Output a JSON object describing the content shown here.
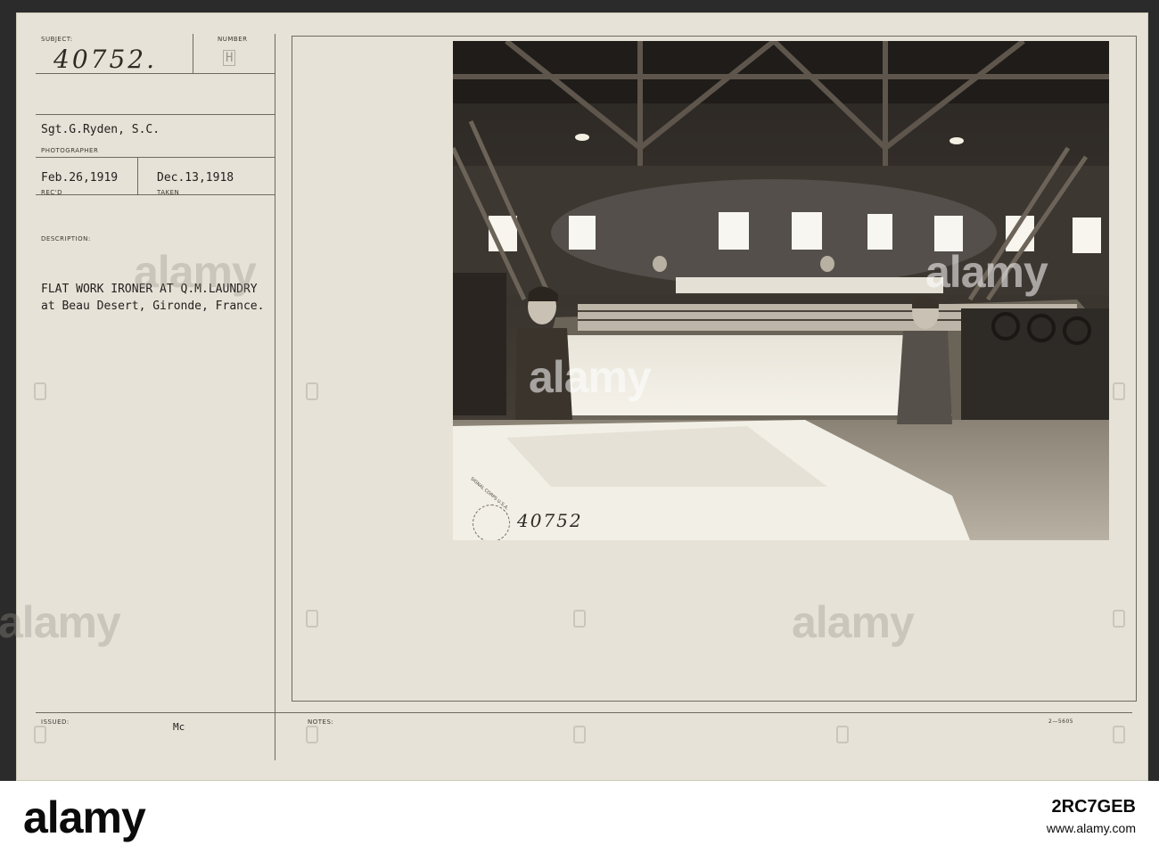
{
  "card": {
    "subject_label": "SUBJECT:",
    "number_label": "NUMBER",
    "subject_value": "40752.",
    "number_value": "H",
    "photographer_name": "Sgt.G.Ryden, S.C.",
    "photographer_label": "PHOTOGRAPHER",
    "recd_date": "Feb.26,1919",
    "recd_label": "REC'D",
    "taken_date": "Dec.13,1918",
    "taken_label": "TAKEN",
    "description_label": "DESCRIPTION:",
    "description_line1": "FLAT WORK IRONER AT Q.M.LAUNDRY",
    "description_line2": "at Beau Desert, Gironde, France.",
    "issued_label": "ISSUED:",
    "issued_value": "Mc",
    "notes_label": "NOTES:",
    "form_number": "2—5605"
  },
  "photo": {
    "stamp_text": "SIGNAL CORPS U.S.A.",
    "photo_number": "40752"
  },
  "watermark": {
    "text": "alamy"
  },
  "footer": {
    "logo": "alamy",
    "image_id": "2RC7GEB",
    "url": "www.alamy.com"
  },
  "colors": {
    "card_bg": "#e6e2d7",
    "ink": "#232020",
    "footer_bg": "#ffffff"
  }
}
